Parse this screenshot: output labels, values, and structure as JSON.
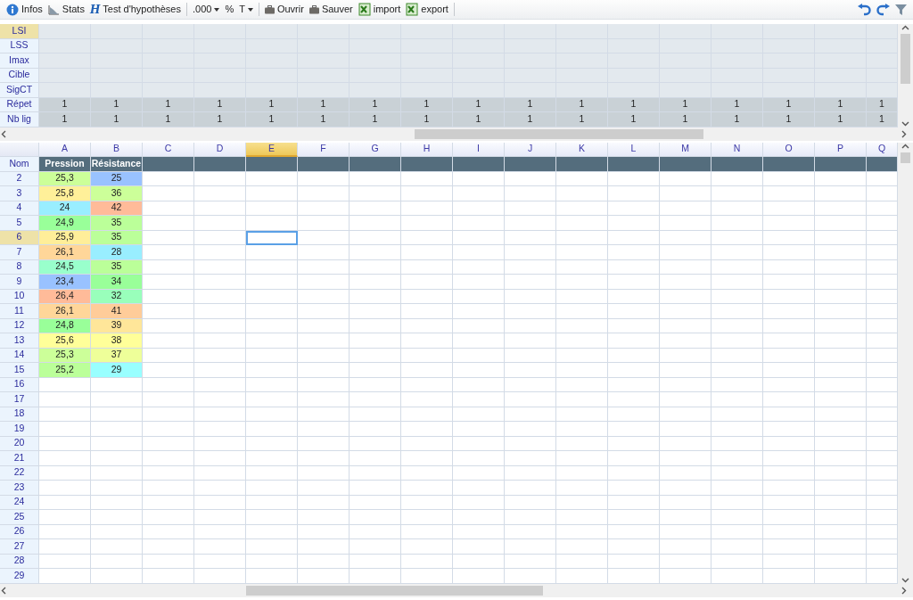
{
  "toolbar": [
    {
      "kind": "button",
      "label": "Infos"
    },
    {
      "kind": "button",
      "label": "Stats"
    },
    {
      "kind": "button",
      "glyph": "H",
      "label": "Test d'hypothèses"
    },
    {
      "kind": "separator"
    },
    {
      "kind": "dropdown",
      "label": ".000"
    },
    {
      "kind": "button",
      "label": "%"
    },
    {
      "kind": "dropdown",
      "label": "T"
    },
    {
      "kind": "separator"
    },
    {
      "kind": "button",
      "label": "Ouvrir"
    },
    {
      "kind": "button",
      "label": "Sauver"
    },
    {
      "kind": "button",
      "label": "import"
    },
    {
      "kind": "button",
      "label": "export"
    },
    {
      "kind": "separator"
    }
  ],
  "limits_grid": {
    "rows": [
      {
        "label": "LSI",
        "selected": true,
        "kind": "limit",
        "cells": []
      },
      {
        "label": "LSS",
        "selected": false,
        "kind": "limit",
        "cells": []
      },
      {
        "label": "Imax",
        "selected": false,
        "kind": "limit",
        "cells": []
      },
      {
        "label": "Cible",
        "selected": false,
        "kind": "limit",
        "cells": []
      },
      {
        "label": "SigCT",
        "selected": false,
        "kind": "limit",
        "cells": []
      },
      {
        "label": "Répet",
        "selected": false,
        "kind": "count",
        "cells": [
          "1",
          "1",
          "1",
          "1",
          "1",
          "1",
          "1",
          "1",
          "1",
          "1",
          "1",
          "1",
          "1",
          "1",
          "1",
          "1",
          "1"
        ]
      },
      {
        "label": "Nb lig",
        "selected": false,
        "kind": "count",
        "cells": [
          "1",
          "1",
          "1",
          "1",
          "1",
          "1",
          "1",
          "1",
          "1",
          "1",
          "1",
          "1",
          "1",
          "1",
          "1",
          "1",
          "1"
        ]
      }
    ]
  },
  "data_grid": {
    "columns": [
      {
        "letter": "A",
        "selected": false
      },
      {
        "letter": "B",
        "selected": false
      },
      {
        "letter": "C",
        "selected": false
      },
      {
        "letter": "D",
        "selected": false
      },
      {
        "letter": "E",
        "selected": true
      },
      {
        "letter": "F",
        "selected": false
      },
      {
        "letter": "G",
        "selected": false
      },
      {
        "letter": "H",
        "selected": false
      },
      {
        "letter": "I",
        "selected": false
      },
      {
        "letter": "J",
        "selected": false
      },
      {
        "letter": "K",
        "selected": false
      },
      {
        "letter": "L",
        "selected": false
      },
      {
        "letter": "M",
        "selected": false
      },
      {
        "letter": "N",
        "selected": false
      },
      {
        "letter": "O",
        "selected": false
      },
      {
        "letter": "P",
        "selected": false
      },
      {
        "letter": "Q",
        "selected": false
      }
    ],
    "name_row": {
      "label": "Nom",
      "names": [
        "Pression",
        "Résistance"
      ]
    },
    "rows": [
      {
        "number": "2",
        "selected": false,
        "cells": [
          {
            "value": "25,3",
            "color": "#ccff99"
          },
          {
            "value": "25",
            "color": "#99c2ff"
          }
        ]
      },
      {
        "number": "3",
        "selected": false,
        "cells": [
          {
            "value": "25,8",
            "color": "#fff099"
          },
          {
            "value": "36",
            "color": "#ccff99"
          }
        ]
      },
      {
        "number": "4",
        "selected": false,
        "cells": [
          {
            "value": "24",
            "color": "#99eeff"
          },
          {
            "value": "42",
            "color": "#ffbb99"
          }
        ]
      },
      {
        "number": "5",
        "selected": false,
        "cells": [
          {
            "value": "24,9",
            "color": "#99ff99"
          },
          {
            "value": "35",
            "color": "#bbff99"
          }
        ]
      },
      {
        "number": "6",
        "selected": true,
        "cells": [
          {
            "value": "25,9",
            "color": "#ffee99"
          },
          {
            "value": "35",
            "color": "#bbff99"
          }
        ]
      },
      {
        "number": "7",
        "selected": false,
        "cells": [
          {
            "value": "26,1",
            "color": "#ffd699"
          },
          {
            "value": "28",
            "color": "#99eeff"
          }
        ]
      },
      {
        "number": "8",
        "selected": false,
        "cells": [
          {
            "value": "24,5",
            "color": "#99ffcc"
          },
          {
            "value": "35",
            "color": "#bbff99"
          }
        ]
      },
      {
        "number": "9",
        "selected": false,
        "cells": [
          {
            "value": "23,4",
            "color": "#99c2ff"
          },
          {
            "value": "34",
            "color": "#99ff99"
          }
        ]
      },
      {
        "number": "10",
        "selected": false,
        "cells": [
          {
            "value": "26,4",
            "color": "#ffbb99"
          },
          {
            "value": "32",
            "color": "#99ffbb"
          }
        ]
      },
      {
        "number": "11",
        "selected": false,
        "cells": [
          {
            "value": "26,1",
            "color": "#ffd699"
          },
          {
            "value": "41",
            "color": "#ffcc99"
          }
        ]
      },
      {
        "number": "12",
        "selected": false,
        "cells": [
          {
            "value": "24,8",
            "color": "#99ff99"
          },
          {
            "value": "39",
            "color": "#ffe699"
          }
        ]
      },
      {
        "number": "13",
        "selected": false,
        "cells": [
          {
            "value": "25,6",
            "color": "#ffff99"
          },
          {
            "value": "38",
            "color": "#ffff99"
          }
        ]
      },
      {
        "number": "14",
        "selected": false,
        "cells": [
          {
            "value": "25,3",
            "color": "#ccff99"
          },
          {
            "value": "37",
            "color": "#eeff99"
          }
        ]
      },
      {
        "number": "15",
        "selected": false,
        "cells": [
          {
            "value": "25,2",
            "color": "#bbff99"
          },
          {
            "value": "29",
            "color": "#99ffff"
          }
        ]
      },
      {
        "number": "16",
        "selected": false,
        "cells": []
      },
      {
        "number": "17",
        "selected": false,
        "cells": []
      },
      {
        "number": "18",
        "selected": false,
        "cells": []
      },
      {
        "number": "19",
        "selected": false,
        "cells": []
      },
      {
        "number": "20",
        "selected": false,
        "cells": []
      },
      {
        "number": "21",
        "selected": false,
        "cells": []
      },
      {
        "number": "22",
        "selected": false,
        "cells": []
      },
      {
        "number": "23",
        "selected": false,
        "cells": []
      },
      {
        "number": "24",
        "selected": false,
        "cells": []
      },
      {
        "number": "25",
        "selected": false,
        "cells": []
      },
      {
        "number": "26",
        "selected": false,
        "cells": []
      },
      {
        "number": "27",
        "selected": false,
        "cells": []
      },
      {
        "number": "28",
        "selected": false,
        "cells": []
      },
      {
        "number": "29",
        "selected": false,
        "cells": []
      }
    ]
  }
}
